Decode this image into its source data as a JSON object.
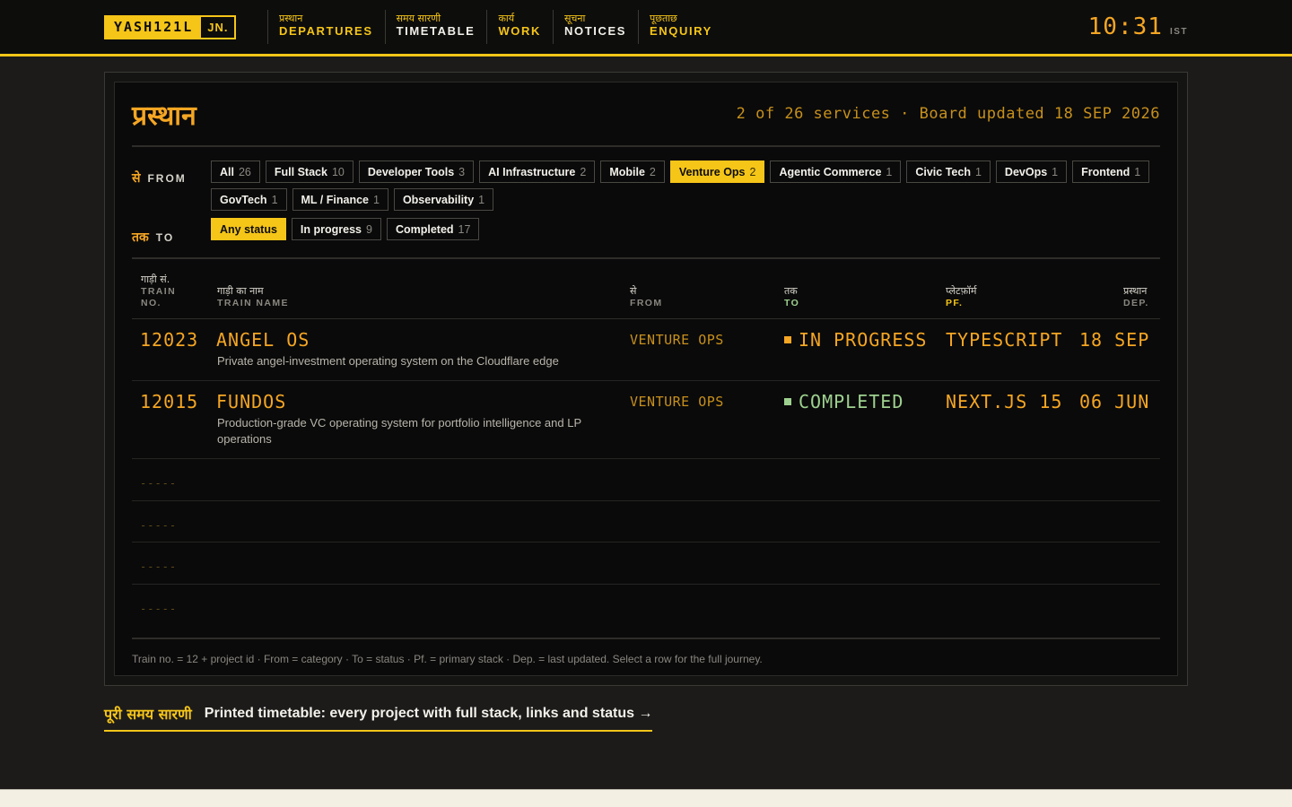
{
  "header": {
    "logo_main": "YASH121L",
    "logo_suffix": "JN.",
    "nav": [
      {
        "hi": "प्रस्थान",
        "en": "DEPARTURES"
      },
      {
        "hi": "समय सारणी",
        "en": "TIMETABLE"
      },
      {
        "hi": "कार्य",
        "en": "WORK"
      },
      {
        "hi": "सूचना",
        "en": "NOTICES"
      },
      {
        "hi": "पूछताछ",
        "en": "ENQUIRY"
      }
    ],
    "clock": "10:31",
    "timezone": "IST"
  },
  "board": {
    "title": "प्रस्थान",
    "meta": "2 of 26 services · Board updated 18 SEP 2026",
    "from_label_hi": "से",
    "from_label_en": "FROM",
    "to_label_hi": "तक",
    "to_label_en": "TO",
    "categories": [
      {
        "label": "All",
        "count": "26",
        "active": false
      },
      {
        "label": "Full Stack",
        "count": "10",
        "active": false
      },
      {
        "label": "Developer Tools",
        "count": "3",
        "active": false
      },
      {
        "label": "AI Infrastructure",
        "count": "2",
        "active": false
      },
      {
        "label": "Mobile",
        "count": "2",
        "active": false
      },
      {
        "label": "Venture Ops",
        "count": "2",
        "active": true
      },
      {
        "label": "Agentic Commerce",
        "count": "1",
        "active": false
      },
      {
        "label": "Civic Tech",
        "count": "1",
        "active": false
      },
      {
        "label": "DevOps",
        "count": "1",
        "active": false
      },
      {
        "label": "Frontend",
        "count": "1",
        "active": false
      },
      {
        "label": "GovTech",
        "count": "1",
        "active": false
      },
      {
        "label": "ML / Finance",
        "count": "1",
        "active": false
      },
      {
        "label": "Observability",
        "count": "1",
        "active": false
      }
    ],
    "statuses": [
      {
        "label": "Any status",
        "count": "",
        "active": true
      },
      {
        "label": "In progress",
        "count": "9",
        "active": false
      },
      {
        "label": "Completed",
        "count": "17",
        "active": false
      }
    ],
    "columns": {
      "train_no": {
        "hi": "गाड़ी सं.",
        "en1": "TRAIN",
        "en2": "NO."
      },
      "train_name": {
        "hi": "गाड़ी का नाम",
        "en": "TRAIN NAME"
      },
      "from": {
        "hi": "से",
        "en": "FROM"
      },
      "to": {
        "hi": "तक",
        "en": "TO"
      },
      "pf": {
        "hi": "प्लेटफ़ॉर्म",
        "en": "PF."
      },
      "dep": {
        "hi": "प्रस्थान",
        "en": "DEP."
      }
    },
    "rows": [
      {
        "no": "12023",
        "name": "ANGEL OS",
        "desc": "Private angel-investment operating system on the Cloudflare edge",
        "from": "VENTURE OPS",
        "status": "IN PROGRESS",
        "status_color": "#f5a623",
        "pf": "TYPESCRIPT",
        "dep": "18 SEP"
      },
      {
        "no": "12015",
        "name": "FUNDOS",
        "desc": "Production-grade VC operating system for portfolio intelligence and LP operations",
        "from": "VENTURE OPS",
        "status": "COMPLETED",
        "status_color": "#9ed18f",
        "pf": "NEXT.JS 15",
        "dep": "06 JUN"
      }
    ],
    "empty_placeholder": "-----",
    "footnote": "Train no. = 12 + project id · From = category · To = status · Pf. = primary stack · Dep. = last updated. Select a row for the full journey."
  },
  "timetable_link": {
    "hi": "पूरी समय सारणी",
    "en": "Printed timetable: every project with full stack, links and status →"
  },
  "colors": {
    "accent": "#f5c518",
    "amber": "#f5a623",
    "completed": "#9ed18f"
  }
}
